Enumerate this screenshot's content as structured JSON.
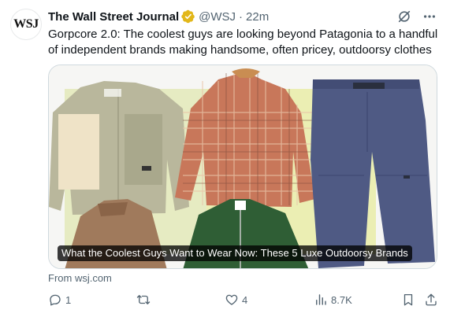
{
  "tweet": {
    "avatar_text": "WSJ",
    "author_name": "The Wall Street Journal",
    "handle": "@WSJ",
    "separator": "·",
    "time": "22m",
    "text": "Gorpcore 2.0: The coolest guys are looking beyond Patagonia to a handful of independent brands making handsome, often pricey, outdoorsy clothes"
  },
  "card": {
    "caption": "What the Coolest Guys Want to Wear Now: These 5 Luxe Outdoorsy Brands",
    "source": "From wsj.com"
  },
  "actions": {
    "replies": "1",
    "reposts": "",
    "likes": "4",
    "views": "8.7K"
  },
  "icons": {
    "verified": "verified-badge-icon",
    "grok": "grok-icon",
    "more": "more-icon",
    "reply": "reply-icon",
    "repost": "repost-icon",
    "like": "like-icon",
    "views": "views-icon",
    "bookmark": "bookmark-icon",
    "share": "share-icon"
  },
  "colors": {
    "text_primary": "#0f1419",
    "text_secondary": "#536471",
    "verified_gold": "#e2b719",
    "card_border": "#cfd9de"
  }
}
